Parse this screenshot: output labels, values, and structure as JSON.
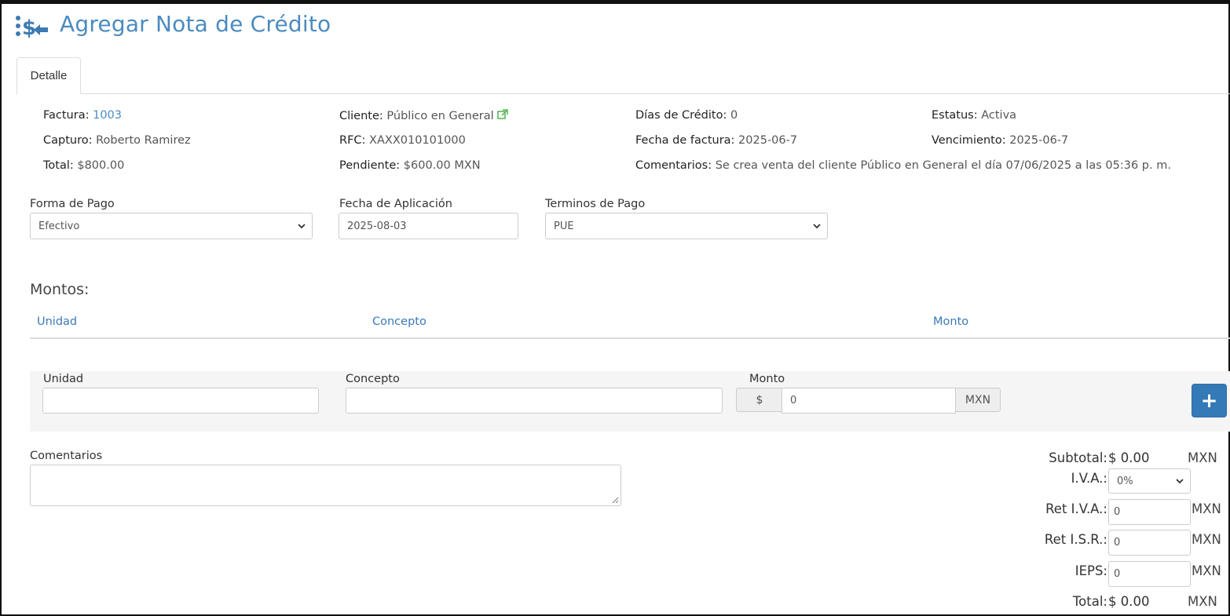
{
  "header": {
    "title": "Agregar Nota de Crédito",
    "icon": "money-transfer-icon"
  },
  "tabs": [
    {
      "label": "Detalle",
      "active": true
    }
  ],
  "details": {
    "factura": {
      "label": "Factura:",
      "value": "1003"
    },
    "cliente": {
      "label": "Cliente:",
      "value": "Público en General",
      "icon": "external-link-icon"
    },
    "dias_credito": {
      "label": "Días de Crédito:",
      "value": "0"
    },
    "estatus": {
      "label": "Estatus:",
      "value": "Activa"
    },
    "capturo": {
      "label": "Capturo:",
      "value": "Roberto Ramirez"
    },
    "rfc": {
      "label": "RFC:",
      "value": "XAXX010101000"
    },
    "fecha_factura": {
      "label": "Fecha de factura:",
      "value": "2025-06-7"
    },
    "vencimiento": {
      "label": "Vencimiento:",
      "value": "2025-06-7"
    },
    "total": {
      "label": "Total:",
      "value": "$800.00"
    },
    "pendiente": {
      "label": "Pendiente:",
      "value": "$600.00 MXN"
    },
    "comentarios": {
      "label": "Comentarios:",
      "value": "Se crea venta del cliente Público en General el día 07/06/2025 a las 05:36 p. m."
    }
  },
  "form": {
    "forma_pago": {
      "label": "Forma de Pago",
      "value": "Efectivo"
    },
    "fecha_aplicacion": {
      "label": "Fecha de Aplicación",
      "value": "2025-08-03"
    },
    "terminos_pago": {
      "label": "Terminos de Pago",
      "value": "PUE"
    }
  },
  "montos": {
    "heading": "Montos:",
    "columns": [
      "Unidad",
      "Concepto",
      "Monto"
    ],
    "rows": []
  },
  "add_row": {
    "unidad_label": "Unidad",
    "unidad_value": "",
    "concepto_label": "Concepto",
    "concepto_value": "",
    "monto_label": "Monto",
    "currency_prefix": "$",
    "monto_value": "0",
    "currency_suffix": "MXN",
    "add_button_icon": "plus-icon",
    "add_button_label": "+"
  },
  "comentarios": {
    "label": "Comentarios",
    "value": ""
  },
  "totals": {
    "subtotal_label": "Subtotal:",
    "subtotal_value": "$ 0.00",
    "subtotal_currency": "MXN",
    "iva_label": "I.V.A.:",
    "iva_value": "0%",
    "ret_iva_label": "Ret I.V.A.:",
    "ret_iva_value": "0",
    "ret_iva_currency": "MXN",
    "ret_isr_label": "Ret I.S.R.:",
    "ret_isr_value": "0",
    "ret_isr_currency": "MXN",
    "ieps_label": "IEPS:",
    "ieps_value": "0",
    "ieps_currency": "MXN",
    "total_label": "Total:",
    "total_value": "$ 0.00",
    "total_currency": "MXN"
  },
  "colors": {
    "accent": "#4a8bc0",
    "link": "#3a7ab8",
    "button": "#337ab7",
    "ext_link_icon": "#5cb85c"
  }
}
